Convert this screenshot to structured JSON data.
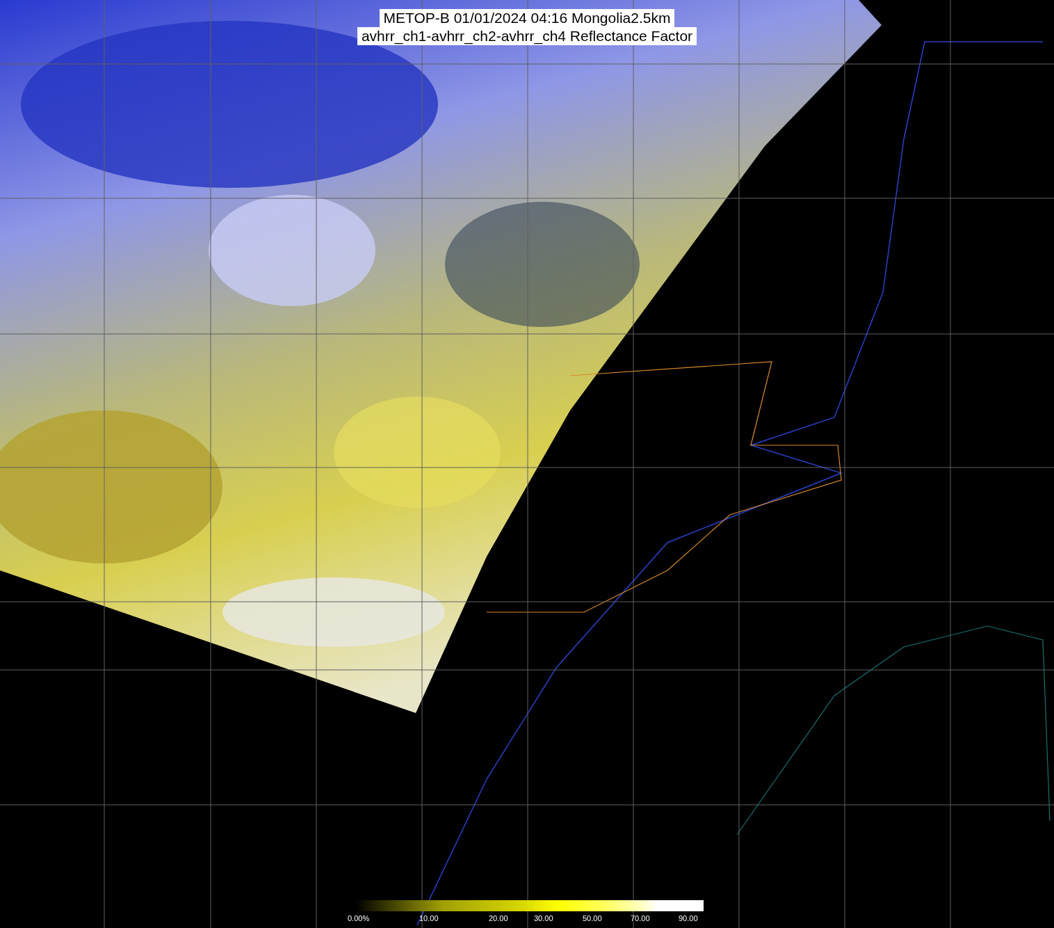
{
  "title": {
    "lines": [
      "METOP-B 01/01/2024 04:16 Mongolia2.5km",
      "avhrr_ch1-avhrr_ch2-avhrr_ch4 Reflectance Factor"
    ]
  },
  "colorbar": {
    "labels": [
      "0.00%",
      "10.00",
      "20.00",
      "30.00",
      "50.00",
      "70.00",
      "90.00"
    ]
  }
}
